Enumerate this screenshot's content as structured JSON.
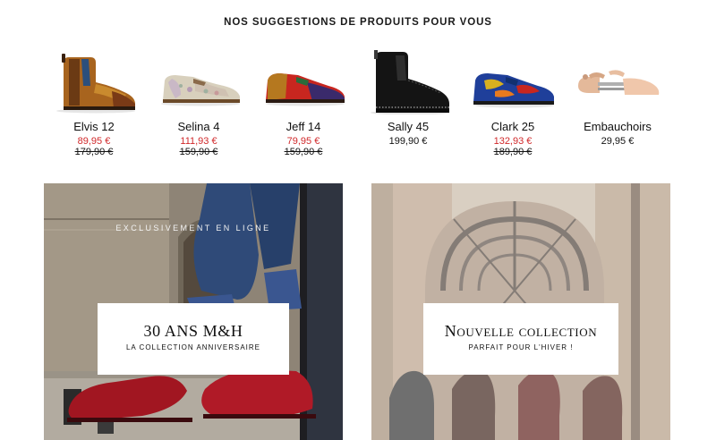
{
  "section": {
    "title": "NOS SUGGESTIONS DE PRODUITS POUR VOUS"
  },
  "products": [
    {
      "name": "Elvis 12",
      "price": "89,95 €",
      "old_price": "179,90 €",
      "on_sale": true,
      "image": "chelsea-boot-brown-multicolor"
    },
    {
      "name": "Selina 4",
      "price": "111,93 €",
      "old_price": "159,90 €",
      "on_sale": true,
      "image": "oxford-floral-beige"
    },
    {
      "name": "Jeff 14",
      "price": "79,95 €",
      "old_price": "159,90 €",
      "on_sale": true,
      "image": "oxford-red-purple"
    },
    {
      "name": "Sally 45",
      "price": "199,90 €",
      "old_price": "",
      "on_sale": false,
      "image": "chelsea-boot-black-studded"
    },
    {
      "name": "Clark 25",
      "price": "132,93 €",
      "old_price": "189,90 €",
      "on_sale": true,
      "image": "oxford-blue-painted"
    },
    {
      "name": "Embauchoirs",
      "price": "29,95 €",
      "old_price": "",
      "on_sale": false,
      "image": "wooden-shoe-tree"
    }
  ],
  "banners": [
    {
      "eyebrow": "EXCLUSIVEMENT EN LIGNE",
      "title": "30 ANS M&H",
      "subtitle": "LA COLLECTION ANNIVERSAIRE"
    },
    {
      "eyebrow": "",
      "title": "Nouvelle collection",
      "subtitle": "PARFAIT POUR L'HIVER !"
    }
  ],
  "colors": {
    "sale_price": "#d0282a",
    "text": "#111111",
    "background": "#ffffff"
  }
}
